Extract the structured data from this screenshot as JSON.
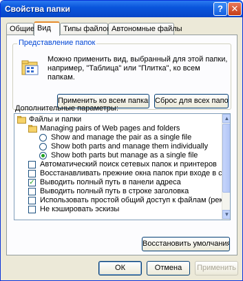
{
  "window": {
    "title": "Свойства папки"
  },
  "titlebar": {
    "help_glyph": "?",
    "close_glyph": "✕"
  },
  "tabs": [
    {
      "label": "Общие"
    },
    {
      "label": "Вид"
    },
    {
      "label": "Типы файлов"
    },
    {
      "label": "Автономные файлы"
    }
  ],
  "active_tab": "Вид",
  "folder_views": {
    "legend": "Представление папок",
    "description": "Можно применить вид, выбранный для этой папки, например, \"Таблица\" или \"Плитка\", ко всем папкам.",
    "apply_all_button": "Применить ко всем папкам",
    "reset_all_button": "Сброс для всех папок"
  },
  "advanced": {
    "legend": "Дополнительные параметры:",
    "items": [
      {
        "type": "folder",
        "label": "Файлы и папки"
      },
      {
        "type": "folder",
        "label": "Managing pairs of Web pages and folders"
      },
      {
        "type": "radio",
        "label": "Show and manage the pair as a single file",
        "checked": false
      },
      {
        "type": "radio",
        "label": "Show both parts and manage them individually",
        "checked": false
      },
      {
        "type": "radio",
        "label": "Show both parts but manage as a single file",
        "checked": true
      },
      {
        "type": "checkbox",
        "label": "Автоматический поиск сетевых папок и принтеров",
        "checked": false
      },
      {
        "type": "checkbox",
        "label": "Восстанавливать прежние окна папок при входе в систему",
        "checked": false
      },
      {
        "type": "checkbox",
        "label": "Выводить полный путь в панели адреса",
        "checked": true
      },
      {
        "type": "checkbox",
        "label": "Выводить полный путь в строке заголовка",
        "checked": false
      },
      {
        "type": "checkbox",
        "label": "Использовать простой общий доступ к файлам (рекомендуется)",
        "checked": false
      },
      {
        "type": "checkbox",
        "label": "Не кэшировать эскизы",
        "checked": false
      }
    ]
  },
  "restore_defaults_button": "Восстановить умолчания",
  "footer": {
    "ok": "ОК",
    "cancel": "Отмена",
    "apply": "Применить"
  },
  "colors": {
    "titlebar": "#0a55dc",
    "accent_tab": "#e68b2c",
    "checkmark": "#21a121",
    "legend_text": "#0046d5"
  }
}
